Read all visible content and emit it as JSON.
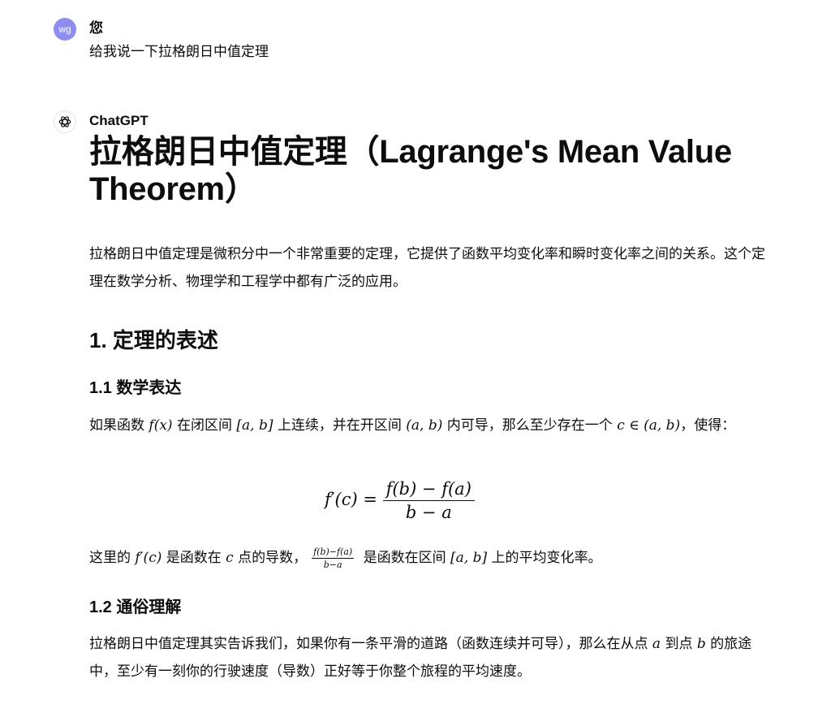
{
  "user": {
    "avatar_initials": "wg",
    "avatar_color": "#8e8ef0",
    "author": "您",
    "message": "给我说一下拉格朗日中值定理"
  },
  "assistant": {
    "author": "ChatGPT",
    "logo_icon": "chatgpt-logo-icon",
    "title": "拉格朗日中值定理（Lagrange's Mean Value Theorem）",
    "intro": "拉格朗日中值定理是微积分中一个非常重要的定理，它提供了函数平均变化率和瞬时变化率之间的关系。这个定理在数学分析、物理学和工程学中都有广泛的应用。",
    "section1_heading": "1. 定理的表述",
    "sub1_heading": "1.1 数学表达",
    "stmt": {
      "t1": "如果函数 ",
      "m1": "f(x)",
      "t2": " 在闭区间 ",
      "m2": "[a, b]",
      "t3": " 上连续，并在开区间 ",
      "m3": "(a, b)",
      "t4": " 内可导，那么至少存在一个 ",
      "m4": "c ∈ (a, b)",
      "t5": "，使得："
    },
    "formula": {
      "lhs": "f′(c) =",
      "num": "f(b) − f(a)",
      "den": "b − a"
    },
    "meaning": {
      "t1": "这里的 ",
      "m1": "f′(c)",
      "t2": " 是函数在 ",
      "m2": "c",
      "t3": " 点的导数，",
      "frac_num": "f(b)−f(a)",
      "frac_den": "b−a",
      "t4": " 是函数在区间 ",
      "m3": "[a, b]",
      "t5": " 上的平均变化率。"
    },
    "sub2_heading": "1.2 通俗理解",
    "explain": {
      "t1": "拉格朗日中值定理其实告诉我们，如果你有一条平滑的道路（函数连续并可导），那么在从点 ",
      "m1": "a",
      "t2": " 到点 ",
      "m2": "b",
      "t3": " 的旅途中，至少有一刻你的行驶速度（导数）正好等于你整个旅程的平均速度。"
    }
  }
}
